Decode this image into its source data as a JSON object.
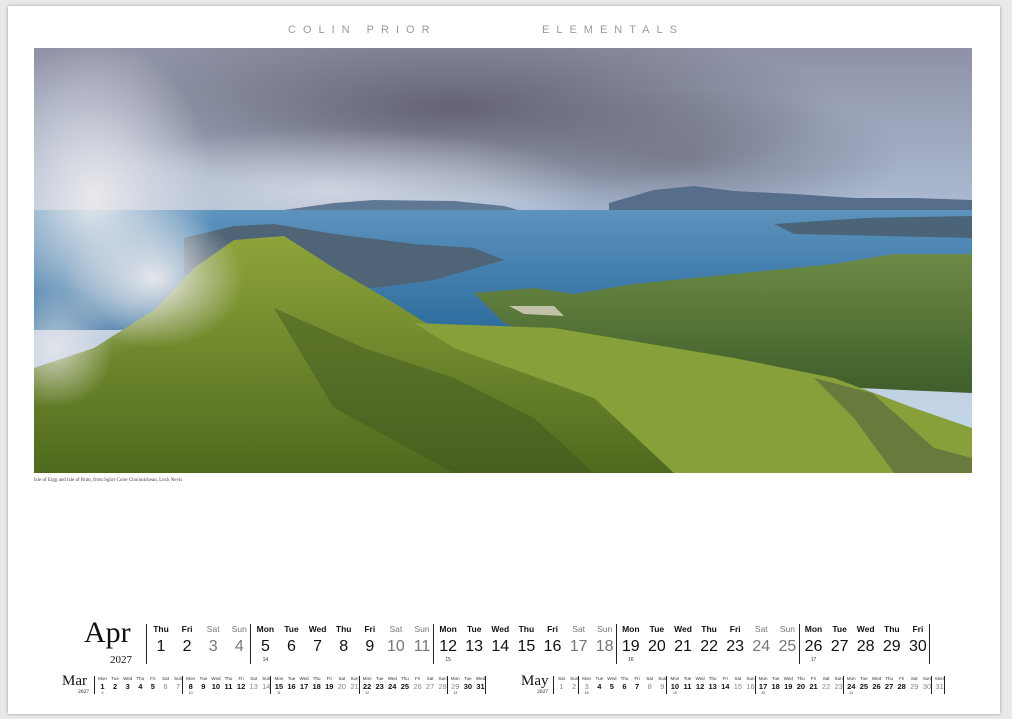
{
  "header": {
    "left": "COLIN PRIOR",
    "right": "ELEMENTALS"
  },
  "photo": {
    "caption": "Isle of Eigg and Isle of Rum, from Sgùrr Coire Choinnichean, Loch Nevis"
  },
  "april": {
    "name": "Apr",
    "year": "2027",
    "days": [
      {
        "dn": "Thu",
        "dd": "1",
        "we": false,
        "wk": ""
      },
      {
        "dn": "Fri",
        "dd": "2",
        "we": false,
        "wk": ""
      },
      {
        "dn": "Sat",
        "dd": "3",
        "we": true,
        "wk": ""
      },
      {
        "dn": "Sun",
        "dd": "4",
        "we": true,
        "wk": ""
      },
      {
        "dn": "Mon",
        "dd": "5",
        "we": false,
        "wk": "14"
      },
      {
        "dn": "Tue",
        "dd": "6",
        "we": false,
        "wk": ""
      },
      {
        "dn": "Wed",
        "dd": "7",
        "we": false,
        "wk": ""
      },
      {
        "dn": "Thu",
        "dd": "8",
        "we": false,
        "wk": ""
      },
      {
        "dn": "Fri",
        "dd": "9",
        "we": false,
        "wk": ""
      },
      {
        "dn": "Sat",
        "dd": "10",
        "we": true,
        "wk": ""
      },
      {
        "dn": "Sun",
        "dd": "11",
        "we": true,
        "wk": ""
      },
      {
        "dn": "Mon",
        "dd": "12",
        "we": false,
        "wk": "15"
      },
      {
        "dn": "Tue",
        "dd": "13",
        "we": false,
        "wk": ""
      },
      {
        "dn": "Wed",
        "dd": "14",
        "we": false,
        "wk": ""
      },
      {
        "dn": "Thu",
        "dd": "15",
        "we": false,
        "wk": ""
      },
      {
        "dn": "Fri",
        "dd": "16",
        "we": false,
        "wk": ""
      },
      {
        "dn": "Sat",
        "dd": "17",
        "we": true,
        "wk": ""
      },
      {
        "dn": "Sun",
        "dd": "18",
        "we": true,
        "wk": ""
      },
      {
        "dn": "Mon",
        "dd": "19",
        "we": false,
        "wk": "16"
      },
      {
        "dn": "Tue",
        "dd": "20",
        "we": false,
        "wk": ""
      },
      {
        "dn": "Wed",
        "dd": "21",
        "we": false,
        "wk": ""
      },
      {
        "dn": "Thu",
        "dd": "22",
        "we": false,
        "wk": ""
      },
      {
        "dn": "Fri",
        "dd": "23",
        "we": false,
        "wk": ""
      },
      {
        "dn": "Sat",
        "dd": "24",
        "we": true,
        "wk": ""
      },
      {
        "dn": "Sun",
        "dd": "25",
        "we": true,
        "wk": ""
      },
      {
        "dn": "Mon",
        "dd": "26",
        "we": false,
        "wk": "17"
      },
      {
        "dn": "Tue",
        "dd": "27",
        "we": false,
        "wk": ""
      },
      {
        "dn": "Wed",
        "dd": "28",
        "we": false,
        "wk": ""
      },
      {
        "dn": "Thu",
        "dd": "29",
        "we": false,
        "wk": ""
      },
      {
        "dn": "Fri",
        "dd": "30",
        "we": false,
        "wk": ""
      }
    ]
  },
  "march": {
    "name": "Mar",
    "year": "2027",
    "days": [
      {
        "dn": "Mon",
        "dd": "1",
        "we": false,
        "wk": "9"
      },
      {
        "dn": "Tue",
        "dd": "2",
        "we": false,
        "wk": ""
      },
      {
        "dn": "Wed",
        "dd": "3",
        "we": false,
        "wk": ""
      },
      {
        "dn": "Thu",
        "dd": "4",
        "we": false,
        "wk": ""
      },
      {
        "dn": "Fri",
        "dd": "5",
        "we": false,
        "wk": ""
      },
      {
        "dn": "Sat",
        "dd": "6",
        "we": true,
        "wk": ""
      },
      {
        "dn": "Sun",
        "dd": "7",
        "we": true,
        "wk": ""
      },
      {
        "dn": "Mon",
        "dd": "8",
        "we": false,
        "wk": "10"
      },
      {
        "dn": "Tue",
        "dd": "9",
        "we": false,
        "wk": ""
      },
      {
        "dn": "Wed",
        "dd": "10",
        "we": false,
        "wk": ""
      },
      {
        "dn": "Thu",
        "dd": "11",
        "we": false,
        "wk": ""
      },
      {
        "dn": "Fri",
        "dd": "12",
        "we": false,
        "wk": ""
      },
      {
        "dn": "Sat",
        "dd": "13",
        "we": true,
        "wk": ""
      },
      {
        "dn": "Sun",
        "dd": "14",
        "we": true,
        "wk": ""
      },
      {
        "dn": "Mon",
        "dd": "15",
        "we": false,
        "wk": "11"
      },
      {
        "dn": "Tue",
        "dd": "16",
        "we": false,
        "wk": ""
      },
      {
        "dn": "Wed",
        "dd": "17",
        "we": false,
        "wk": ""
      },
      {
        "dn": "Thu",
        "dd": "18",
        "we": false,
        "wk": ""
      },
      {
        "dn": "Fri",
        "dd": "19",
        "we": false,
        "wk": ""
      },
      {
        "dn": "Sat",
        "dd": "20",
        "we": true,
        "wk": ""
      },
      {
        "dn": "Sun",
        "dd": "21",
        "we": true,
        "wk": ""
      },
      {
        "dn": "Mon",
        "dd": "22",
        "we": false,
        "wk": "12"
      },
      {
        "dn": "Tue",
        "dd": "23",
        "we": false,
        "wk": ""
      },
      {
        "dn": "Wed",
        "dd": "24",
        "we": false,
        "wk": ""
      },
      {
        "dn": "Thu",
        "dd": "25",
        "we": false,
        "wk": ""
      },
      {
        "dn": "Fri",
        "dd": "26",
        "we": true,
        "wk": ""
      },
      {
        "dn": "Sat",
        "dd": "27",
        "we": true,
        "wk": ""
      },
      {
        "dn": "Sun",
        "dd": "28",
        "we": true,
        "wk": ""
      },
      {
        "dn": "Mon",
        "dd": "29",
        "we": true,
        "wk": "13"
      },
      {
        "dn": "Tue",
        "dd": "30",
        "we": false,
        "wk": ""
      },
      {
        "dn": "Wed",
        "dd": "31",
        "we": false,
        "wk": ""
      }
    ]
  },
  "may": {
    "name": "May",
    "year": "2027",
    "days": [
      {
        "dn": "Sat",
        "dd": "1",
        "we": true,
        "wk": ""
      },
      {
        "dn": "Sun",
        "dd": "2",
        "we": true,
        "wk": ""
      },
      {
        "dn": "Mon",
        "dd": "3",
        "we": true,
        "wk": "18"
      },
      {
        "dn": "Tue",
        "dd": "4",
        "we": false,
        "wk": ""
      },
      {
        "dn": "Wed",
        "dd": "5",
        "we": false,
        "wk": ""
      },
      {
        "dn": "Thu",
        "dd": "6",
        "we": false,
        "wk": ""
      },
      {
        "dn": "Fri",
        "dd": "7",
        "we": false,
        "wk": ""
      },
      {
        "dn": "Sat",
        "dd": "8",
        "we": true,
        "wk": ""
      },
      {
        "dn": "Sun",
        "dd": "9",
        "we": true,
        "wk": ""
      },
      {
        "dn": "Mon",
        "dd": "10",
        "we": false,
        "wk": "19"
      },
      {
        "dn": "Tue",
        "dd": "11",
        "we": false,
        "wk": ""
      },
      {
        "dn": "Wed",
        "dd": "12",
        "we": false,
        "wk": ""
      },
      {
        "dn": "Thu",
        "dd": "13",
        "we": false,
        "wk": ""
      },
      {
        "dn": "Fri",
        "dd": "14",
        "we": false,
        "wk": ""
      },
      {
        "dn": "Sat",
        "dd": "15",
        "we": true,
        "wk": ""
      },
      {
        "dn": "Sun",
        "dd": "16",
        "we": true,
        "wk": ""
      },
      {
        "dn": "Mon",
        "dd": "17",
        "we": false,
        "wk": "20"
      },
      {
        "dn": "Tue",
        "dd": "18",
        "we": false,
        "wk": ""
      },
      {
        "dn": "Wed",
        "dd": "19",
        "we": false,
        "wk": ""
      },
      {
        "dn": "Thu",
        "dd": "20",
        "we": false,
        "wk": ""
      },
      {
        "dn": "Fri",
        "dd": "21",
        "we": false,
        "wk": ""
      },
      {
        "dn": "Sat",
        "dd": "22",
        "we": true,
        "wk": ""
      },
      {
        "dn": "Sun",
        "dd": "23",
        "we": true,
        "wk": ""
      },
      {
        "dn": "Mon",
        "dd": "24",
        "we": false,
        "wk": "21"
      },
      {
        "dn": "Tue",
        "dd": "25",
        "we": false,
        "wk": ""
      },
      {
        "dn": "Wed",
        "dd": "26",
        "we": false,
        "wk": ""
      },
      {
        "dn": "Thu",
        "dd": "27",
        "we": false,
        "wk": ""
      },
      {
        "dn": "Fri",
        "dd": "28",
        "we": false,
        "wk": ""
      },
      {
        "dn": "Sat",
        "dd": "29",
        "we": true,
        "wk": ""
      },
      {
        "dn": "Sun",
        "dd": "30",
        "we": true,
        "wk": ""
      },
      {
        "dn": "Mon",
        "dd": "31",
        "we": true,
        "wk": ""
      }
    ]
  }
}
